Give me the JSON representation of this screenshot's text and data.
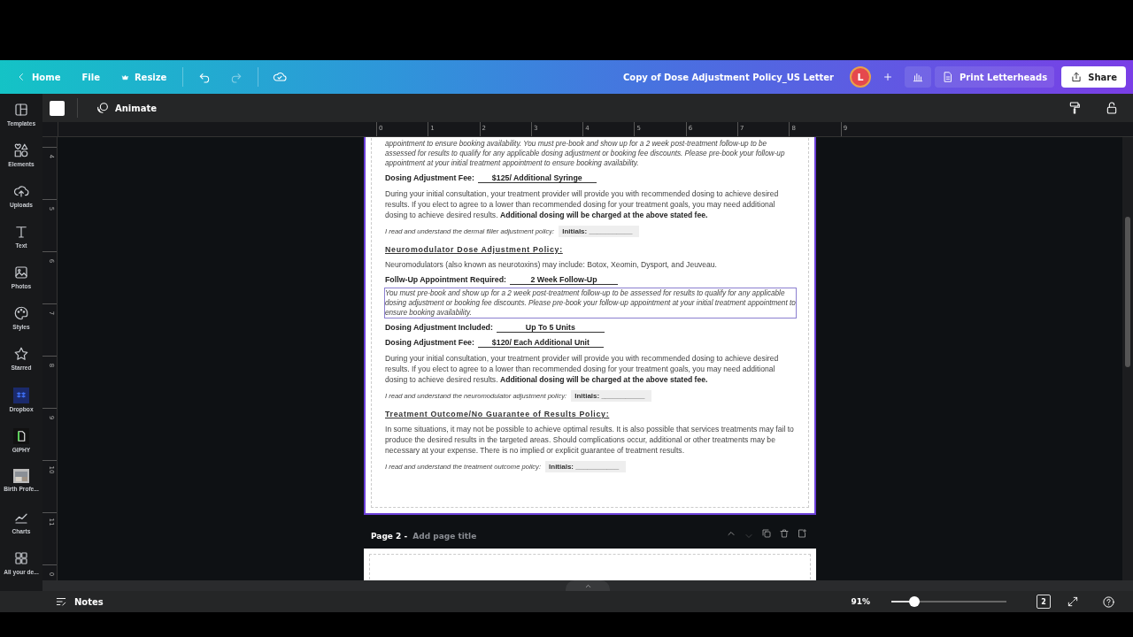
{
  "header": {
    "nav": [
      {
        "kind": "back",
        "label": "Home"
      },
      {
        "kind": "plain",
        "label": "File"
      },
      {
        "kind": "crown",
        "label": "Resize"
      }
    ],
    "title": "Copy of Dose Adjustment Policy_US Letter",
    "avatar": "L",
    "print_button": "Print Letterheads",
    "share_button": "Share"
  },
  "sidebar": {
    "items": [
      {
        "label": "Templates"
      },
      {
        "label": "Elements"
      },
      {
        "label": "Uploads"
      },
      {
        "label": "Text"
      },
      {
        "label": "Photos"
      },
      {
        "label": "Styles"
      },
      {
        "label": "Starred"
      },
      {
        "label": "Dropbox"
      },
      {
        "label": "GIPHY"
      },
      {
        "label": "Birth Profe..."
      },
      {
        "label": "Charts"
      },
      {
        "label": "All your de..."
      }
    ]
  },
  "toolbar": {
    "animate": "Animate"
  },
  "rulers": {
    "horizontal": [
      "0",
      "1",
      "2",
      "3",
      "4",
      "5",
      "6",
      "7",
      "8",
      "9"
    ],
    "vertical": [
      "4",
      "5",
      "6",
      "7",
      "8",
      "9",
      "10",
      "11",
      "0"
    ]
  },
  "page": {
    "blocks": [
      {
        "kind": "italic",
        "text": "appointment to ensure booking availability. You must pre-book and show up for a 2 week post-treatment follow-up to be assessed for results to qualify for any applicable dosing adjustment or booking fee discounts. Please pre-book your follow-up appointment at your initial treatment appointment to ensure booking availability.",
        "selected": false
      },
      {
        "kind": "field",
        "label": "Dosing Adjustment Fee:",
        "value": "$125/ Additional Syringe"
      },
      {
        "kind": "para",
        "text": "During your initial consultation, your treatment provider will provide you with recommended dosing to achieve desired results. If you elect to agree to a lower than recommended dosing for your treatment goals, you may need additional dosing to achieve desired results. **Additional dosing will be charged at the above stated fee.**"
      },
      {
        "kind": "initials",
        "text": "I read and understand the dermal filler adjustment policy:",
        "value": "Initials: ___________"
      },
      {
        "kind": "heading",
        "text": "Neuromodulator Dose Adjustment Policy:"
      },
      {
        "kind": "para",
        "text": "Neuromodulators (also known as neurotoxins) may include: Botox, Xeomin, Dysport, and Jeuveau."
      },
      {
        "kind": "field",
        "label": "Follw-Up Appointment Required:",
        "value": "2 Week Follow-Up"
      },
      {
        "kind": "italic",
        "text": "You must pre-book and show up for a 2 week post-treatment follow-up to be assessed for results to qualify for any applicable dosing adjustment or booking fee discounts. Please pre-book your follow-up appointment at your initial treatment appointment to ensure booking availability.",
        "selected": true
      },
      {
        "kind": "field",
        "label": "Dosing Adjustment Included:",
        "value": "Up To 5 Units"
      },
      {
        "kind": "field",
        "label": "Dosing Adjustment Fee:",
        "value": "$120/ Each Additional Unit"
      },
      {
        "kind": "para",
        "text": "During your initial consultation, your treatment provider will provide you with recommended dosing to achieve desired results. If you elect to agree to a lower than recommended dosing for your treatment goals, you may need additional dosing to achieve desired results. **Additional dosing will be charged at the above stated fee.**"
      },
      {
        "kind": "initials",
        "text": "I read and understand the neuromodulator adjustment policy:",
        "value": "Initials: ___________"
      },
      {
        "kind": "heading",
        "text": "Treatment Outcome/No Guarantee of Results Policy:"
      },
      {
        "kind": "para",
        "text": "In some situations, it may not be possible to achieve optimal results. It is also possible that services treatments may fail to produce the desired results in the targeted areas. Should complications occur, additional or other treatments may be necessary at your expense. There is no implied or explicit guarantee of treatment results."
      },
      {
        "kind": "initials",
        "text": "I read and understand the treatment outcome policy:",
        "value": "Initials: ___________"
      }
    ]
  },
  "page2": {
    "label": "Page 2 -",
    "title_placeholder": "Add page title"
  },
  "bottom_bar": {
    "notes": "Notes",
    "zoom": "91%",
    "zoom_slider": {
      "level": 0.2
    },
    "page_count": "2"
  }
}
